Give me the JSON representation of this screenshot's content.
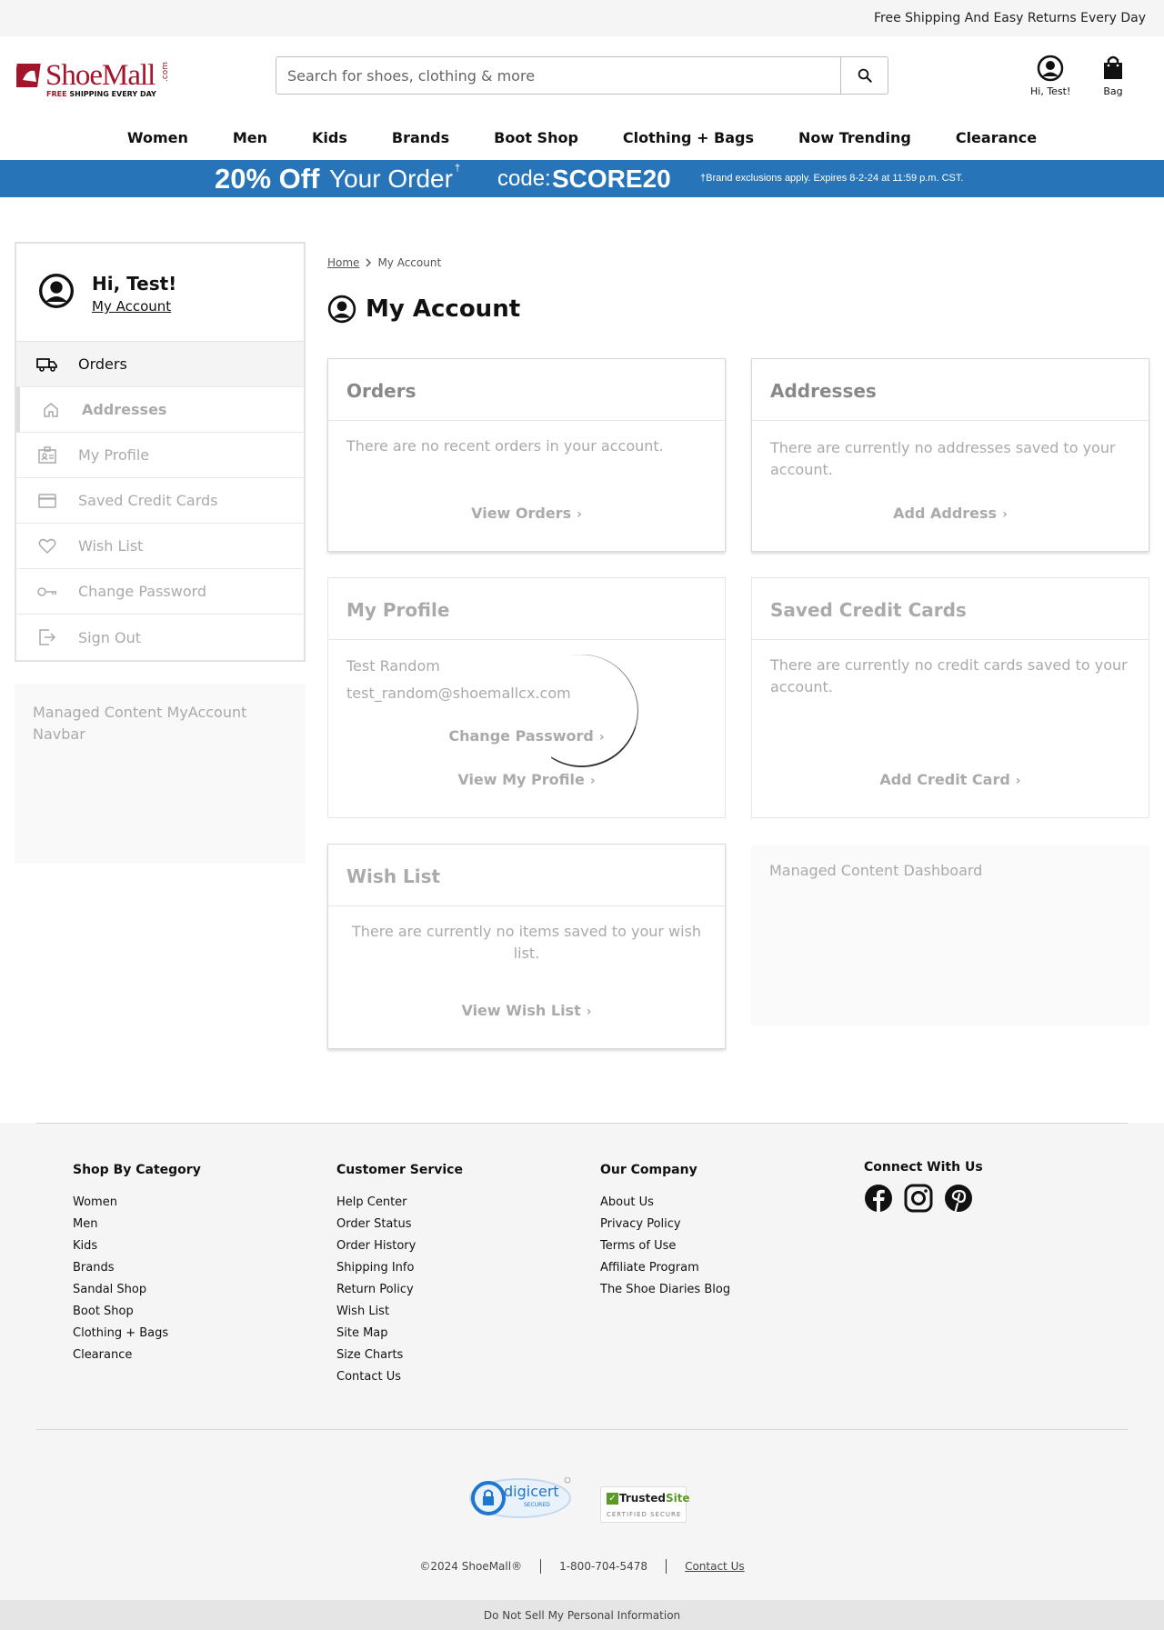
{
  "topbar": {
    "message": "Free Shipping And Easy Returns Every Day"
  },
  "header": {
    "logo_text": "ShoeMall",
    "logo_com": ".com",
    "logo_tag_free": "FREE",
    "logo_tag_rest": "SHIPPING EVERY DAY",
    "search_placeholder": "Search for shoes, clothing & more",
    "account_label": "Hi, Test!",
    "bag_label": "Bag"
  },
  "nav": [
    "Women",
    "Men",
    "Kids",
    "Brands",
    "Boot Shop",
    "Clothing + Bags",
    "Now Trending",
    "Clearance"
  ],
  "promo": {
    "off": "20% Off",
    "your_order": "Your Order",
    "dagger": "†",
    "code_label": "code:",
    "code": "SCORE20",
    "disclaimer": "†Brand exclusions apply. Expires 8-2-24 at 11:59 p.m. CST."
  },
  "sidebar": {
    "greeting": "Hi, Test!",
    "my_account": "My Account",
    "items": [
      {
        "label": "Orders",
        "icon": "truck-icon"
      },
      {
        "label": "Addresses",
        "icon": "home-icon"
      },
      {
        "label": "My Profile",
        "icon": "id-card-icon"
      },
      {
        "label": "Saved Credit Cards",
        "icon": "credit-card-icon"
      },
      {
        "label": "Wish List",
        "icon": "heart-icon"
      },
      {
        "label": "Change Password",
        "icon": "key-icon"
      },
      {
        "label": "Sign Out",
        "icon": "sign-out-icon"
      }
    ],
    "managed_content": "Managed Content MyAccount Navbar"
  },
  "breadcrumb": {
    "home": "Home",
    "current": "My Account"
  },
  "page_title": "My Account",
  "cards": {
    "orders": {
      "title": "Orders",
      "body": "There are no recent orders in your account.",
      "link": "View Orders"
    },
    "addresses": {
      "title": "Addresses",
      "body": "There are currently no addresses saved to your account.",
      "link": "Add Address"
    },
    "profile": {
      "title": "My Profile",
      "name": "Test Random",
      "email": "test_random@shoemallcx.com",
      "link1": "Change Password",
      "link2": "View My Profile"
    },
    "credit_cards": {
      "title": "Saved Credit Cards",
      "body": "There are currently no credit cards saved to your account.",
      "link": "Add Credit Card"
    },
    "wish_list": {
      "title": "Wish List",
      "body": "There are currently no items saved to your wish list.",
      "link": "View Wish List"
    },
    "managed_dashboard": "Managed Content Dashboard"
  },
  "footer": {
    "col1": {
      "title": "Shop By Category",
      "items": [
        "Women",
        "Men",
        "Kids",
        "Brands",
        "Sandal Shop",
        "Boot Shop",
        "Clothing + Bags",
        "Clearance"
      ]
    },
    "col2": {
      "title": "Customer Service",
      "items": [
        "Help Center",
        "Order Status",
        "Order History",
        "Shipping Info",
        "Return Policy",
        "Wish List",
        "Site Map",
        "Size Charts",
        "Contact Us"
      ]
    },
    "col3": {
      "title": "Our Company",
      "items": [
        "About Us",
        "Privacy Policy",
        "Terms of Use",
        "Affiliate Program",
        "The Shoe Diaries Blog"
      ]
    },
    "col4": {
      "title": "Connect With Us"
    },
    "digicert": "digicert",
    "digicert_sub": "SECURED",
    "trusted_a": "Trusted",
    "trusted_b": "Site",
    "trusted_sub": "CERTIFIED SECURE",
    "copyright": "©2024 ShoeMall®",
    "phone": "1-800-704-5478",
    "contact": "Contact Us",
    "do_not_sell": "Do Not Sell My Personal Information"
  },
  "colors": {
    "brand_red": "#a2162b",
    "promo_blue": "#2774b8"
  }
}
